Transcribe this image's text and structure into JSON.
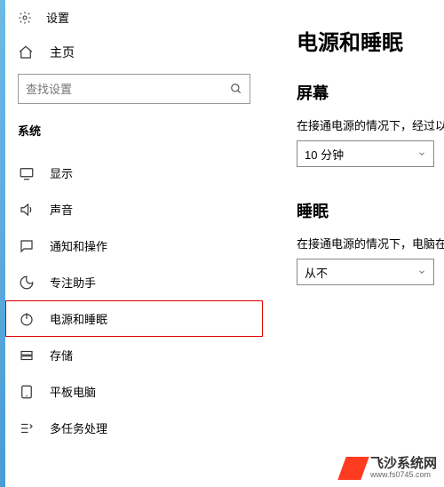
{
  "header": {
    "title": "设置"
  },
  "home": {
    "label": "主页"
  },
  "search": {
    "placeholder": "查找设置"
  },
  "group": {
    "label": "系统"
  },
  "sidebar": {
    "items": [
      {
        "label": "显示",
        "icon": "display-icon"
      },
      {
        "label": "声音",
        "icon": "sound-icon"
      },
      {
        "label": "通知和操作",
        "icon": "notification-icon"
      },
      {
        "label": "专注助手",
        "icon": "focus-assist-icon"
      },
      {
        "label": "电源和睡眠",
        "icon": "power-icon"
      },
      {
        "label": "存储",
        "icon": "storage-icon"
      },
      {
        "label": "平板电脑",
        "icon": "tablet-icon"
      },
      {
        "label": "多任务处理",
        "icon": "multitask-icon"
      }
    ]
  },
  "content": {
    "title": "电源和睡眠",
    "sections": [
      {
        "heading": "屏幕",
        "desc": "在接通电源的情况下，经过以",
        "value": "10 分钟"
      },
      {
        "heading": "睡眠",
        "desc": "在接通电源的情况下，电脑在",
        "value": "从不"
      }
    ]
  },
  "watermark": {
    "name": "飞沙系统网",
    "url": "www.fs0745.com"
  }
}
